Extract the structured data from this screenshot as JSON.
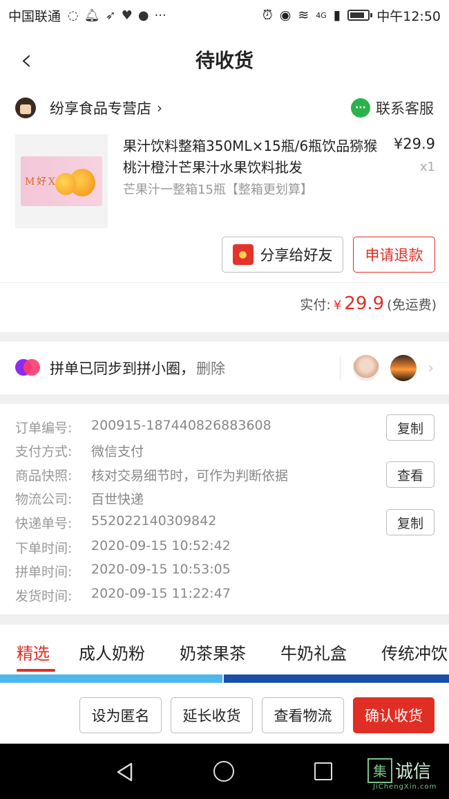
{
  "status_bar": {
    "carrier": "中国联通",
    "network": "4G",
    "time": "中午12:50"
  },
  "nav": {
    "title": "待收货"
  },
  "shop": {
    "name": "纷享食品专营店",
    "contact_label": "联系客服"
  },
  "product": {
    "title": "果汁饮料整箱350ML×15瓶/6瓶饮品猕猴桃汁橙汁芒果汁水果饮料批发",
    "price": "¥29.9",
    "quantity": "x1",
    "spec": "芒果汁一整箱15瓶【整箱更划算】",
    "image_text": "M 好 X 道"
  },
  "actions": {
    "share_label": "分享给好友",
    "refund_label": "申请退款"
  },
  "payment": {
    "label": "实付:",
    "currency": "¥",
    "amount": "29.9",
    "note": "(免运费)"
  },
  "sync": {
    "text": "拼单已同步到拼小圈，",
    "delete_label": "删除"
  },
  "order_info": {
    "order_no_label": "订单编号:",
    "order_no": "200915-187440826883608",
    "pay_method_label": "支付方式:",
    "pay_method": "微信支付",
    "snapshot_label": "商品快照:",
    "snapshot": "核对交易细节时，可作为判断依据",
    "courier_label": "物流公司:",
    "courier": "百世快递",
    "tracking_label": "快递单号:",
    "tracking_no": "552022140309842",
    "order_time_label": "下单时间:",
    "order_time": "2020-09-15 10:52:42",
    "group_time_label": "拼单时间:",
    "group_time": "2020-09-15 10:53:05",
    "ship_time_label": "发货时间:",
    "ship_time": "2020-09-15 11:22:47",
    "copy_label": "复制",
    "view_label": "查看"
  },
  "tabs": [
    "精选",
    "成人奶粉",
    "奶茶果茶",
    "牛奶礼盒",
    "传统冲饮"
  ],
  "bottom_actions": {
    "anonymous": "设为匿名",
    "extend": "延长收货",
    "logistics": "查看物流",
    "confirm": "确认收货"
  },
  "watermark": {
    "mark": "集",
    "text": "诚信",
    "sub": "JiChengXin.com"
  },
  "colors": {
    "accent": "#e02e24",
    "wechat_green": "#2bb24c"
  }
}
